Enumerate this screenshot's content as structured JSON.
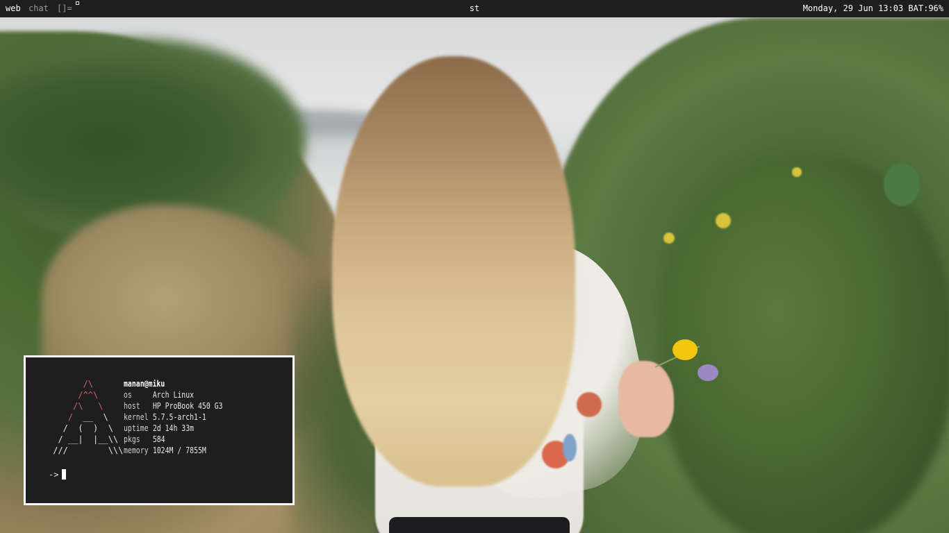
{
  "topbar": {
    "tags": [
      "web",
      "chat"
    ],
    "active_tag": "web",
    "layout_symbol": "[]=",
    "window_title": "st",
    "status": "Monday, 29 Jun 13:03  BAT:96%"
  },
  "terminal": {
    "user_host": "manan@miku",
    "info": [
      {
        "key": "os",
        "value": "Arch Linux"
      },
      {
        "key": "host",
        "value": "HP ProBook 450 G3"
      },
      {
        "key": "kernel",
        "value": "5.7.5-arch1-1"
      },
      {
        "key": "uptime",
        "value": "2d 14h 33m"
      },
      {
        "key": "pkgs",
        "value": "584"
      },
      {
        "key": "memory",
        "value": "1024M / 7855M"
      }
    ],
    "prompt": "->"
  },
  "colors": {
    "bar_bg": "#1e1e1e",
    "terminal_bg": "#1e1e1e",
    "terminal_border": "#ffffff",
    "logo_accent": "#e05a6b",
    "text": "#e8e8e8"
  },
  "icons": {
    "occupied_indicator": "small-square-icon",
    "logo": "arch-ascii-logo"
  }
}
